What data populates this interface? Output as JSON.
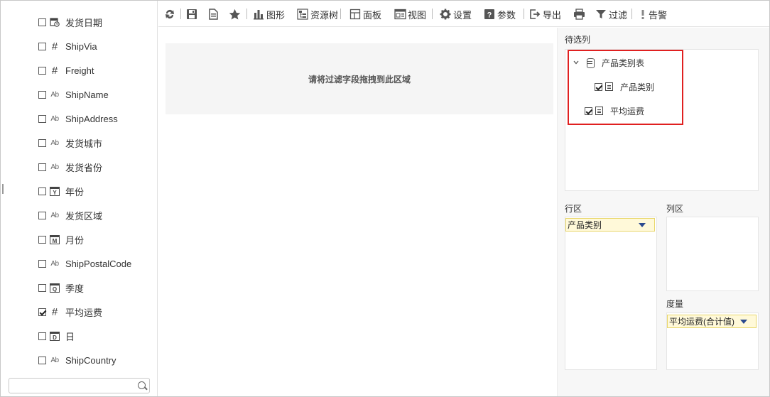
{
  "fields": [
    {
      "label": "发货日期",
      "type": "date",
      "checked": false
    },
    {
      "label": "ShipVia",
      "type": "number",
      "checked": false
    },
    {
      "label": "Freight",
      "type": "number",
      "checked": false
    },
    {
      "label": "ShipName",
      "type": "text",
      "checked": false
    },
    {
      "label": "ShipAddress",
      "type": "text",
      "checked": false
    },
    {
      "label": "发货城市",
      "type": "text",
      "checked": false
    },
    {
      "label": "发货省份",
      "type": "text",
      "checked": false
    },
    {
      "label": "年份",
      "type": "year",
      "icon_letter": "Y",
      "checked": false
    },
    {
      "label": "发货区域",
      "type": "text",
      "checked": false
    },
    {
      "label": "月份",
      "type": "month",
      "icon_letter": "M",
      "checked": false
    },
    {
      "label": "ShipPostalCode",
      "type": "text",
      "checked": false
    },
    {
      "label": "季度",
      "type": "quarter",
      "icon_letter": "Q",
      "checked": false
    },
    {
      "label": "平均运费",
      "type": "number",
      "checked": true
    },
    {
      "label": "日",
      "type": "day",
      "icon_letter": "D",
      "checked": false
    },
    {
      "label": "ShipCountry",
      "type": "text",
      "checked": false
    }
  ],
  "search": {
    "value": "",
    "placeholder": ""
  },
  "toolbar": {
    "chart": "图形",
    "resource_tree": "资源树",
    "panel": "面板",
    "view": "视图",
    "settings": "设置",
    "params": "参数",
    "export": "导出",
    "filter": "过滤",
    "alert": "告警"
  },
  "drop_hint": "请将过滤字段拖拽到此区域",
  "right": {
    "candidate_label": "待选列",
    "tree": {
      "parent": "产品类别表",
      "child": "产品类别",
      "sibling": "平均运费"
    },
    "row_label": "行区",
    "column_label": "列区",
    "measure_label": "度量",
    "row_chip": "产品类别",
    "measure_chip": "平均运费(合计值)"
  },
  "colors": {
    "accent_red": "#e02020",
    "chip_bg": "#fff9d9",
    "chip_border": "#e8d66a",
    "arrow_blue": "#2b4a8f"
  }
}
